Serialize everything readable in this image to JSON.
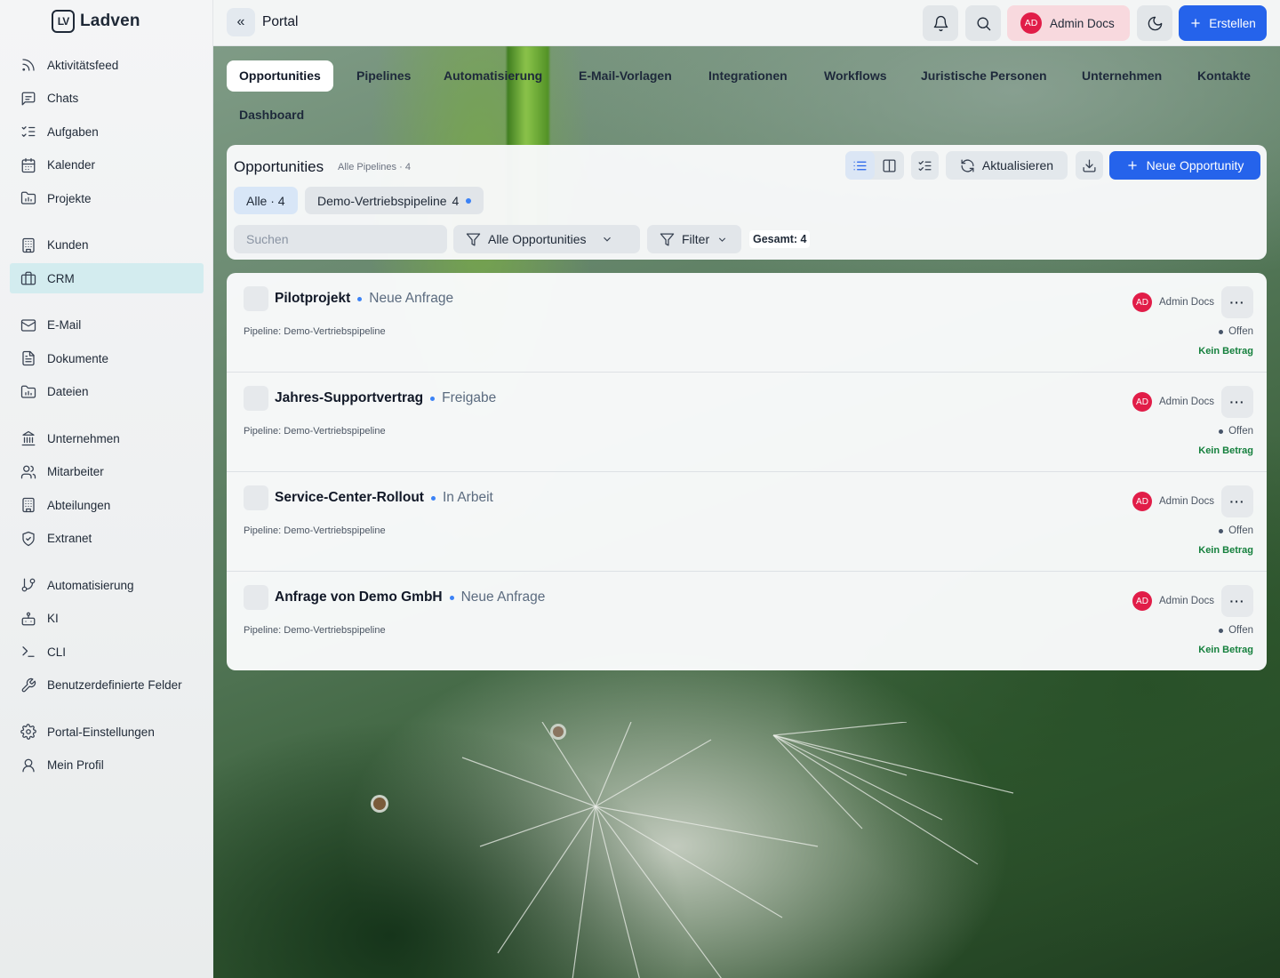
{
  "app": {
    "name": "Ladven",
    "logo_text": "LV"
  },
  "sidebar": {
    "groups": [
      [
        {
          "label": "Aktivitätsfeed",
          "icon": "rss-icon"
        },
        {
          "label": "Chats",
          "icon": "chat-icon"
        },
        {
          "label": "Aufgaben",
          "icon": "tasks-icon"
        },
        {
          "label": "Kalender",
          "icon": "calendar-icon"
        },
        {
          "label": "Projekte",
          "icon": "folder-chart-icon"
        }
      ],
      [
        {
          "label": "Kunden",
          "icon": "building-icon"
        },
        {
          "label": "CRM",
          "icon": "briefcase-icon",
          "active": true
        }
      ],
      [
        {
          "label": "E-Mail",
          "icon": "mail-icon"
        },
        {
          "label": "Dokumente",
          "icon": "document-icon"
        },
        {
          "label": "Dateien",
          "icon": "folder-icon"
        }
      ],
      [
        {
          "label": "Unternehmen",
          "icon": "bank-icon"
        },
        {
          "label": "Mitarbeiter",
          "icon": "users-icon"
        },
        {
          "label": "Abteilungen",
          "icon": "building-icon"
        },
        {
          "label": "Extranet",
          "icon": "shield-check-icon"
        }
      ],
      [
        {
          "label": "Automatisierung",
          "icon": "git-branch-icon"
        },
        {
          "label": "KI",
          "icon": "robot-icon"
        },
        {
          "label": "CLI",
          "icon": "terminal-icon"
        },
        {
          "label": "Benutzerdefinierte Felder",
          "icon": "wrench-icon"
        }
      ],
      [
        {
          "label": "Portal-Einstellungen",
          "icon": "gear-icon"
        },
        {
          "label": "Mein Profil",
          "icon": "user-icon"
        }
      ]
    ]
  },
  "topbar": {
    "collapse_glyph": "«",
    "title": "Portal",
    "user": {
      "initials": "AD",
      "name": "Admin Docs"
    },
    "create_label": "Erstellen"
  },
  "tabs": [
    {
      "label": "Opportunities",
      "active": true
    },
    {
      "label": "Pipelines"
    },
    {
      "label": "Automatisierung"
    },
    {
      "label": "E-Mail-Vorlagen"
    },
    {
      "label": "Integrationen"
    },
    {
      "label": "Workflows"
    },
    {
      "label": "Juristische Personen"
    },
    {
      "label": "Unternehmen"
    },
    {
      "label": "Kontakte"
    },
    {
      "label": "Dashboard"
    }
  ],
  "panel": {
    "title": "Opportunities",
    "subtitle": "Alle Pipelines · 4",
    "refresh_label": "Aktualisieren",
    "new_label": "Neue Opportunity",
    "chip_all": "Alle · 4",
    "chip_pipeline": "Demo-Vertriebspipeline",
    "chip_pipeline_count": "4",
    "search_placeholder": "Suchen",
    "filter_scope": "Alle Opportunities",
    "filter_label": "Filter",
    "total": "Gesamt: 4"
  },
  "opportunities": [
    {
      "title": "Pilotprojekt",
      "stage": "Neue Anfrage",
      "pipeline": "Pipeline: Demo-Vertriebspipeline",
      "owner_initials": "AD",
      "owner": "Admin Docs",
      "status": "Offen",
      "amount": "Kein Betrag"
    },
    {
      "title": "Jahres-Supportvertrag",
      "stage": "Freigabe",
      "pipeline": "Pipeline: Demo-Vertriebspipeline",
      "owner_initials": "AD",
      "owner": "Admin Docs",
      "status": "Offen",
      "amount": "Kein Betrag"
    },
    {
      "title": "Service-Center-Rollout",
      "stage": "In Arbeit",
      "pipeline": "Pipeline: Demo-Vertriebspipeline",
      "owner_initials": "AD",
      "owner": "Admin Docs",
      "status": "Offen",
      "amount": "Kein Betrag"
    },
    {
      "title": "Anfrage von Demo GmbH",
      "stage": "Neue Anfrage",
      "pipeline": "Pipeline: Demo-Vertriebspipeline",
      "owner_initials": "AD",
      "owner": "Admin Docs",
      "status": "Offen",
      "amount": "Kein Betrag"
    }
  ],
  "colors": {
    "accent": "#2563eb",
    "avatar": "#e11d48",
    "active_nav": "#d3ecef",
    "amount": "#15803d"
  }
}
